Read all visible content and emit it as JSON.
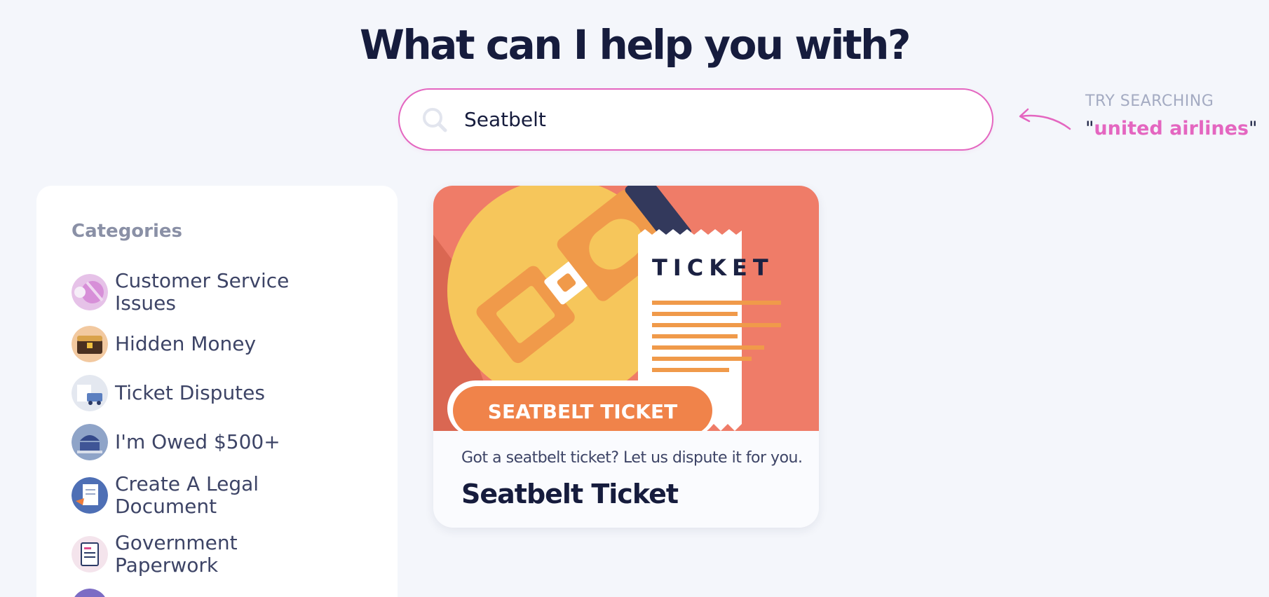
{
  "heading": "What can I help you with?",
  "search": {
    "value": "Seatbelt",
    "icon": "search-icon"
  },
  "hint": {
    "label": "TRY SEARCHING",
    "quote_open": "\"",
    "query": "united airlines",
    "quote_close": "\""
  },
  "sidebar": {
    "title": "Categories",
    "items": [
      {
        "label": "Customer Service Issues",
        "line1": "Customer Service",
        "line2": "Issues"
      },
      {
        "label": "Hidden Money",
        "line1": "Hidden Money",
        "line2": ""
      },
      {
        "label": "Ticket Disputes",
        "line1": "Ticket Disputes",
        "line2": ""
      },
      {
        "label": "I'm Owed $500+",
        "line1": "I'm Owed $500+",
        "line2": ""
      },
      {
        "label": "Create A Legal Document",
        "line1": "Create A Legal",
        "line2": "Document"
      },
      {
        "label": "Government Paperwork",
        "line1": "Government",
        "line2": "Paperwork"
      }
    ]
  },
  "results": [
    {
      "image_ticket_text": "TICKET",
      "image_badge_text": "SEATBELT TICKET",
      "description": "Got a seatbelt ticket? Let us dispute it for you.",
      "title": "Seatbelt Ticket"
    }
  ],
  "colors": {
    "accent": "#e466c0",
    "heading": "#161c3d",
    "background": "#f4f6fb",
    "card_image_bg": "#ef7c68"
  }
}
